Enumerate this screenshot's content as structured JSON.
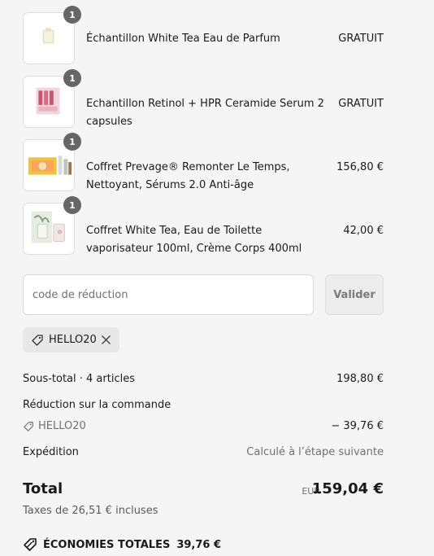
{
  "items": [
    {
      "qty": "1",
      "name": "Échantillon White Tea Eau de Parfum",
      "price": "GRATUIT"
    },
    {
      "qty": "1",
      "name": "Echantillon Retinol + HPR Ceramide Serum 2 capsules",
      "price": "GRATUIT"
    },
    {
      "qty": "1",
      "name": "Coffret Prevage® Remonter Le Temps, Nettoyant, Sérums 2.0 Anti-âge",
      "price": "156,80 €"
    },
    {
      "qty": "1",
      "name": "Coffret White Tea, Eau de Toilette vaporisateur 100ml, Crème Corps 400ml",
      "price": "42,00 €"
    }
  ],
  "discount": {
    "placeholder": "code de réduction",
    "apply_label": "Valider",
    "applied_code": "HELLO20"
  },
  "summary": {
    "subtotal_label": "Sous-total · 4 articles",
    "subtotal_value": "198,80 €",
    "order_discount_label": "Réduction sur la commande",
    "order_discount_code": "HELLO20",
    "order_discount_value": "− 39,76 €",
    "shipping_label": "Expédition",
    "shipping_value": "Calculé à l’étape suivante",
    "total_label": "Total",
    "currency": "EUR",
    "total_value": "159,04 €",
    "tax_note": "Taxes de 26,51 € incluses",
    "savings_label": "ÉCONOMIES TOTALES",
    "savings_value": "39,76 €"
  }
}
